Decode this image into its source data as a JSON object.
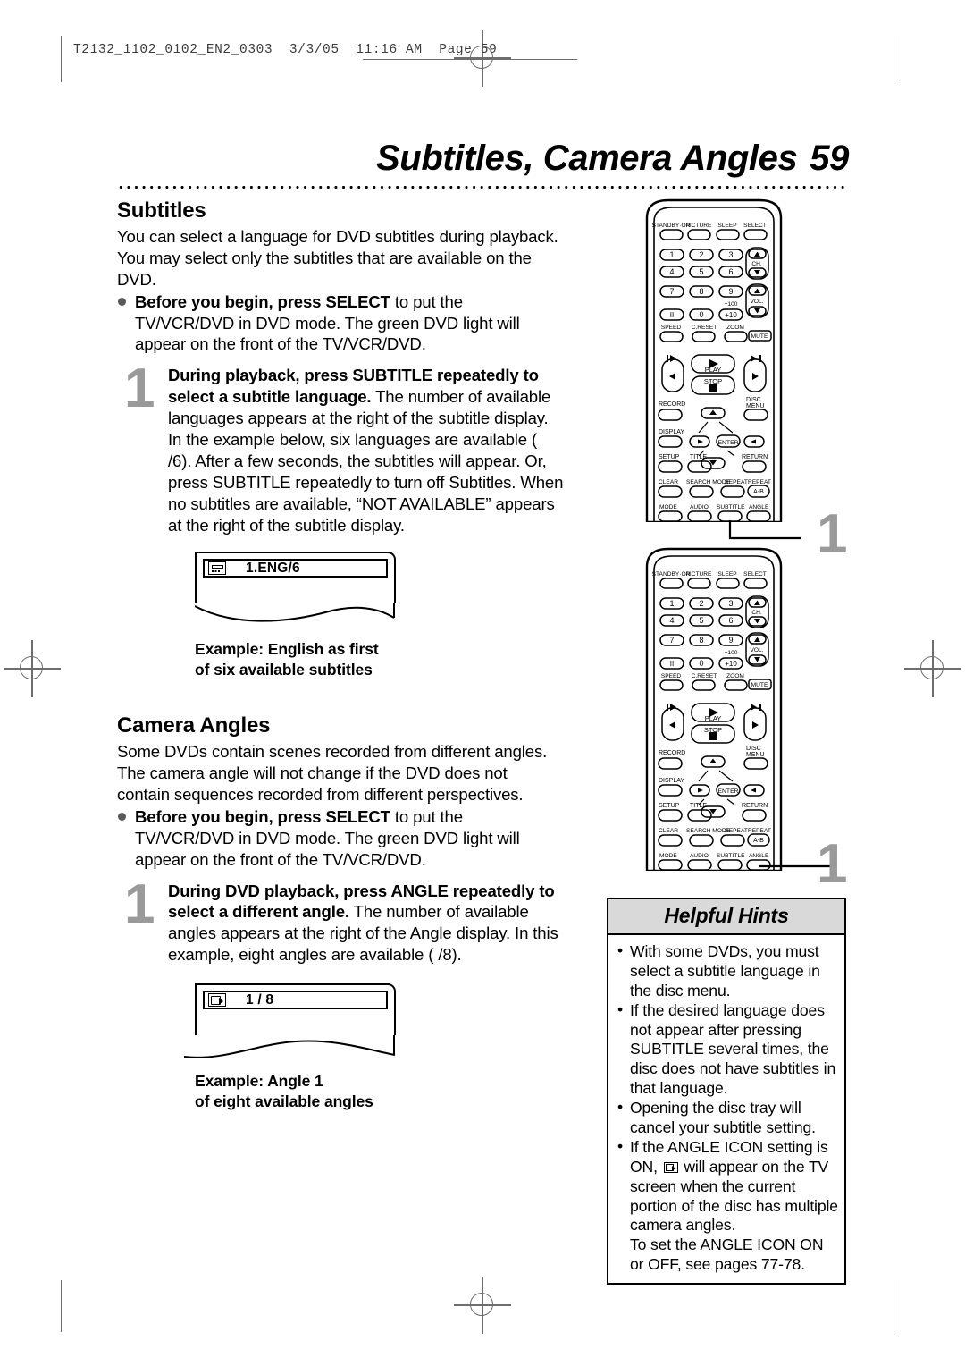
{
  "print_slug": "T2132_1102_0102_EN2_0303  3/3/05  11:16 AM  Page 59",
  "header": {
    "title": "Subtitles, Camera Angles",
    "page_number": "59"
  },
  "sections": {
    "subtitles": {
      "heading": "Subtitles",
      "intro": "You can select a language for DVD subtitles during playback. You may select only the subtitles that are available on the DVD.",
      "bullet_bold": "Before you begin, press SELECT",
      "bullet_rest": " to put the TV/VCR/DVD in DVD mode. The green DVD light will appear on the front of the TV/VCR/DVD.",
      "step_number": "1",
      "step_bold": "During playback, press SUBTITLE repeatedly to select a subtitle language.",
      "step_rest": "  The number of available languages appears at the right of the subtitle display. In the example below, six languages are available (  /6). After a few seconds, the subtitles will appear. Or, press SUBTITLE repeatedly to turn off Subtitles. When no subtitles are available, “NOT AVAILABLE” appears at the right of the subtitle display.",
      "osd_icon": "subtitle-icon",
      "osd_value": "1.ENG/6",
      "caption_line1": "Example: English as first",
      "caption_line2": "of six available subtitles"
    },
    "camera_angles": {
      "heading": "Camera Angles",
      "intro": "Some DVDs contain scenes recorded from different angles. The camera angle will not change if the DVD does not contain sequences recorded from different perspectives.",
      "bullet_bold": "Before you begin, press SELECT",
      "bullet_rest": " to put the TV/VCR/DVD in DVD mode. The green DVD light will appear on the front of the TV/VCR/DVD.",
      "step_number": "1",
      "step_bold": "During DVD playback, press ANGLE repeatedly to select a different angle.",
      "step_rest": " The number of available angles appears at the right of the Angle display. In this example, eight angles are available (  /8).",
      "osd_icon": "camera-angle-icon",
      "osd_value": "1 / 8",
      "caption_line1": "Example: Angle 1",
      "caption_line2": "of eight available angles"
    }
  },
  "remote": {
    "callout_top": "1",
    "callout_bottom": "1",
    "rows": {
      "top_labels": [
        "STANDBY·ON",
        "PICTURE",
        "SLEEP",
        "SELECT"
      ],
      "numeric": [
        "1",
        "2",
        "3",
        "4",
        "5",
        "6",
        "7",
        "8",
        "9",
        "0"
      ],
      "pause_label": "II",
      "plus_ten": "+10",
      "plus_hundred": "+100",
      "ch_label": "CH.",
      "vol_label": "VOL.",
      "mute_label": "MUTE",
      "row_speed": [
        "SPEED",
        "C.RESET",
        "ZOOM"
      ],
      "transport": [
        "PLAY",
        "STOP"
      ],
      "record_label": "RECORD",
      "disc_menu_label": "DISC MENU",
      "display_label": "DISPLAY",
      "enter_label": "ENTER",
      "setup_label": "SETUP",
      "title_label": "TITLE",
      "return_label": "RETURN",
      "clear_label": "CLEAR",
      "search_mode_label": "SEARCH MODE",
      "repeat_label": "REPEAT",
      "repeat_ab_label": "REPEAT",
      "ab_label": "A-B",
      "mode_label": "MODE",
      "audio_label": "AUDIO",
      "subtitle_label": "SUBTITLE",
      "angle_label": "ANGLE"
    }
  },
  "helpful_hints": {
    "title": "Helpful Hints",
    "items": [
      "With some DVDs, you must select a subtitle language in the disc menu.",
      "If the desired language does not appear after pressing SUBTITLE several times, the disc does not have subtitles in that language.",
      "Opening the disc tray will cancel your subtitle setting."
    ],
    "angle_hint_part1": "If the ANGLE ICON setting is ON, ",
    "angle_hint_part2": " will appear on the TV screen when the current portion of the disc has multiple camera angles.",
    "angle_hint_part3": "To set the ANGLE ICON ON or OFF, see pages 77-78."
  },
  "colors": {
    "step_number": "#9a9a9a",
    "bullet": "#595959",
    "hints_header_bg": "#d9d9d9",
    "ink": "#000000"
  }
}
